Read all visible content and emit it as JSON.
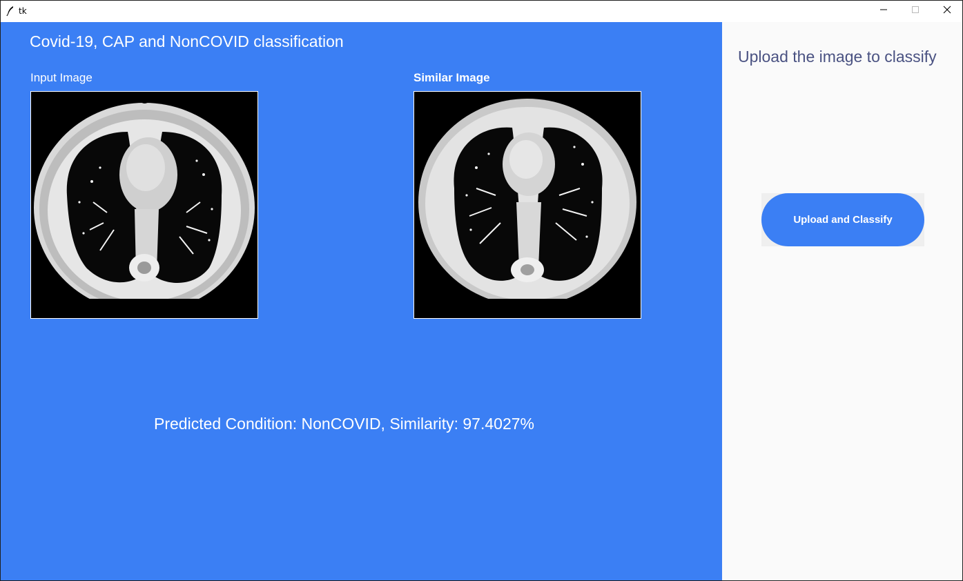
{
  "window": {
    "title": "tk",
    "controls": [
      "minimize-icon",
      "maximize-icon",
      "close-icon"
    ]
  },
  "main": {
    "title": "Covid-19, CAP and NonCOVID classification",
    "input_label": "Input Image",
    "similar_label": "Similar Image",
    "prediction_text": "Predicted Condition: NonCOVID, Similarity: 97.4027%"
  },
  "side": {
    "title": "Upload the image to classify",
    "upload_button_label": "Upload and Classify"
  },
  "colors": {
    "main_background": "#3b7ff4",
    "side_background": "#fafafa",
    "side_title": "#4a5282",
    "button": "#3b7ff4"
  }
}
